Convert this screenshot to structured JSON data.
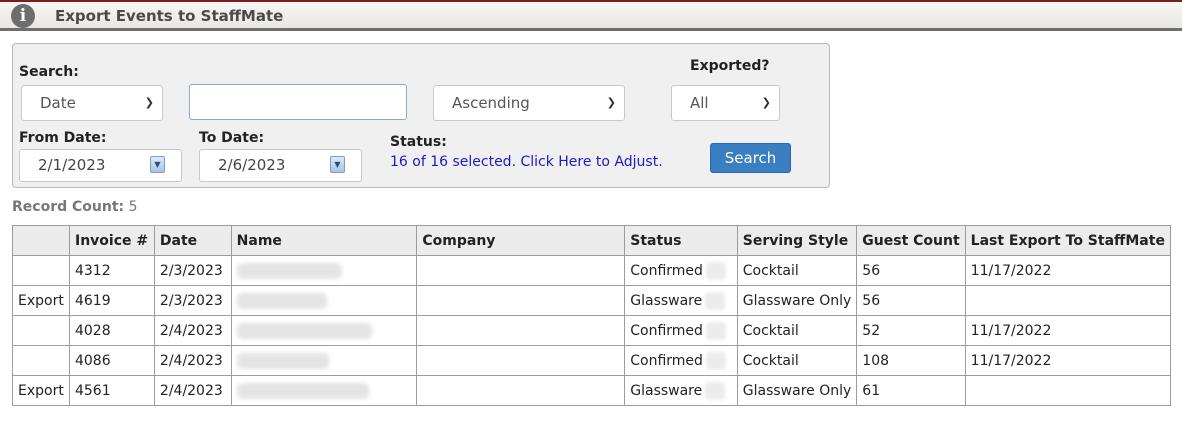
{
  "header": {
    "title": "Export Events to StaffMate",
    "icon": "info-icon"
  },
  "search": {
    "label": "Search:",
    "field_select": "Date",
    "text_value": "",
    "order_select": "Ascending",
    "exported_label": "Exported?",
    "exported_select": "All",
    "from_label": "From Date:",
    "from_value": "2/1/2023",
    "to_label": "To Date:",
    "to_value": "2/6/2023",
    "status_label": "Status:",
    "status_link": "16 of 16 selected. Click Here to Adjust.",
    "search_button": "Search"
  },
  "record_count": {
    "label": "Record Count:",
    "value": "5"
  },
  "table": {
    "columns": [
      "",
      "Invoice #",
      "Date",
      "Name",
      "Company",
      "Status",
      "Serving Style",
      "Guest Count",
      "Last Export To StaffMate"
    ],
    "rows": [
      {
        "action": "",
        "invoice": "4312",
        "date": "2/3/2023",
        "company": "",
        "status": "Confirmed",
        "style": "Cocktail",
        "guests": "56",
        "last_export": "11/17/2022"
      },
      {
        "action": "Export",
        "invoice": "4619",
        "date": "2/3/2023",
        "company": "",
        "status": "Glassware",
        "style": "Glassware Only",
        "guests": "56",
        "last_export": ""
      },
      {
        "action": "",
        "invoice": "4028",
        "date": "2/4/2023",
        "company": "",
        "status": "Confirmed",
        "style": "Cocktail",
        "guests": "52",
        "last_export": "11/17/2022"
      },
      {
        "action": "",
        "invoice": "4086",
        "date": "2/4/2023",
        "company": "",
        "status": "Confirmed",
        "style": "Cocktail",
        "guests": "108",
        "last_export": "11/17/2022"
      },
      {
        "action": "Export",
        "invoice": "4561",
        "date": "2/4/2023",
        "company": "",
        "status": "Glassware",
        "style": "Glassware Only",
        "guests": "61",
        "last_export": ""
      }
    ]
  }
}
